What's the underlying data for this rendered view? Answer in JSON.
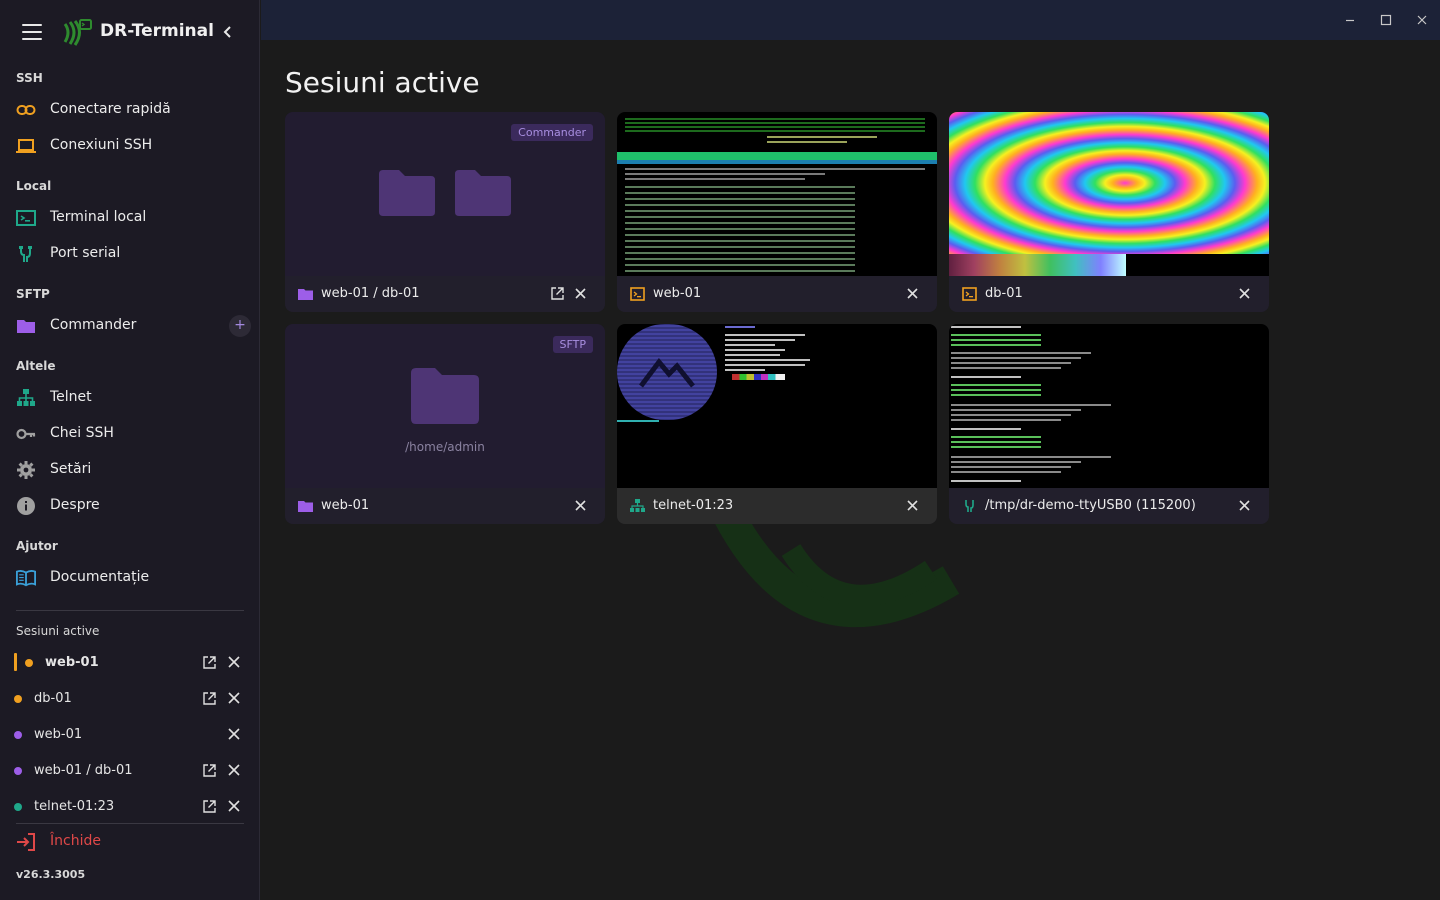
{
  "app": {
    "title": "DR-Terminal",
    "version": "v26.3.3005"
  },
  "colors": {
    "accent_orange": "#f0a020",
    "accent_purple": "#9d5ee8",
    "accent_teal": "#1fa88a",
    "danger": "#e04848",
    "logo_green": "#2e8b2e"
  },
  "sidebar": {
    "sections": {
      "ssh": "SSH",
      "local": "Local",
      "sftp": "SFTP",
      "other": "Altele",
      "help": "Ajutor",
      "active": "Sesiuni active"
    },
    "items": {
      "quick_connect": "Conectare rapidă",
      "ssh_connections": "Conexiuni SSH",
      "local_terminal": "Terminal local",
      "serial_port": "Port serial",
      "commander": "Commander",
      "telnet": "Telnet",
      "ssh_keys": "Chei SSH",
      "settings": "Setări",
      "about": "Despre",
      "docs": "Documentație"
    },
    "sessions": [
      {
        "label": "web-01",
        "dot": "#f0a020"
      },
      {
        "label": "db-01",
        "dot": "#f0a020"
      },
      {
        "label": "web-01",
        "dot": "#9d5ee8"
      },
      {
        "label": "web-01 / db-01",
        "dot": "#9d5ee8"
      },
      {
        "label": "telnet-01:23",
        "dot": "#1fa88a"
      }
    ],
    "quit": "Închide"
  },
  "main": {
    "title": "Sesiuni active",
    "cards": [
      {
        "label": "web-01 / db-01",
        "badge": "Commander"
      },
      {
        "label": "web-01"
      },
      {
        "label": "db-01"
      },
      {
        "label": "web-01",
        "badge": "SFTP",
        "path": "/home/admin"
      },
      {
        "label": "telnet-01:23"
      },
      {
        "label": "/tmp/dr-demo-ttyUSB0 (115200)"
      }
    ]
  }
}
